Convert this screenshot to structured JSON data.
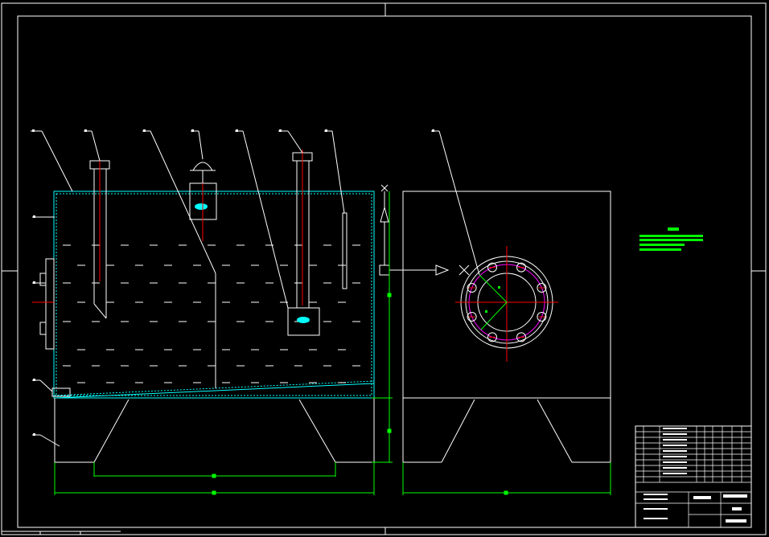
{
  "title_block": {
    "drawing_name": "",
    "drawing_number": "",
    "company": ""
  },
  "note_block": {
    "heading": "",
    "lines": []
  },
  "leaders": [
    {
      "id": "1"
    },
    {
      "id": "2"
    },
    {
      "id": "3"
    },
    {
      "id": "4"
    },
    {
      "id": "5"
    },
    {
      "id": "6"
    },
    {
      "id": "7"
    },
    {
      "id": "8"
    },
    {
      "id": "9"
    },
    {
      "id": "10"
    },
    {
      "id": "11"
    }
  ],
  "flange_bolts": 8,
  "colors": {
    "background": "#000000",
    "outline": "#ffffff",
    "tank_wall": "#00ffff",
    "centerline": "#ff0000",
    "dimension": "#00ff00",
    "bolt_circle": "#ff00ff",
    "note": "#00ff00"
  }
}
